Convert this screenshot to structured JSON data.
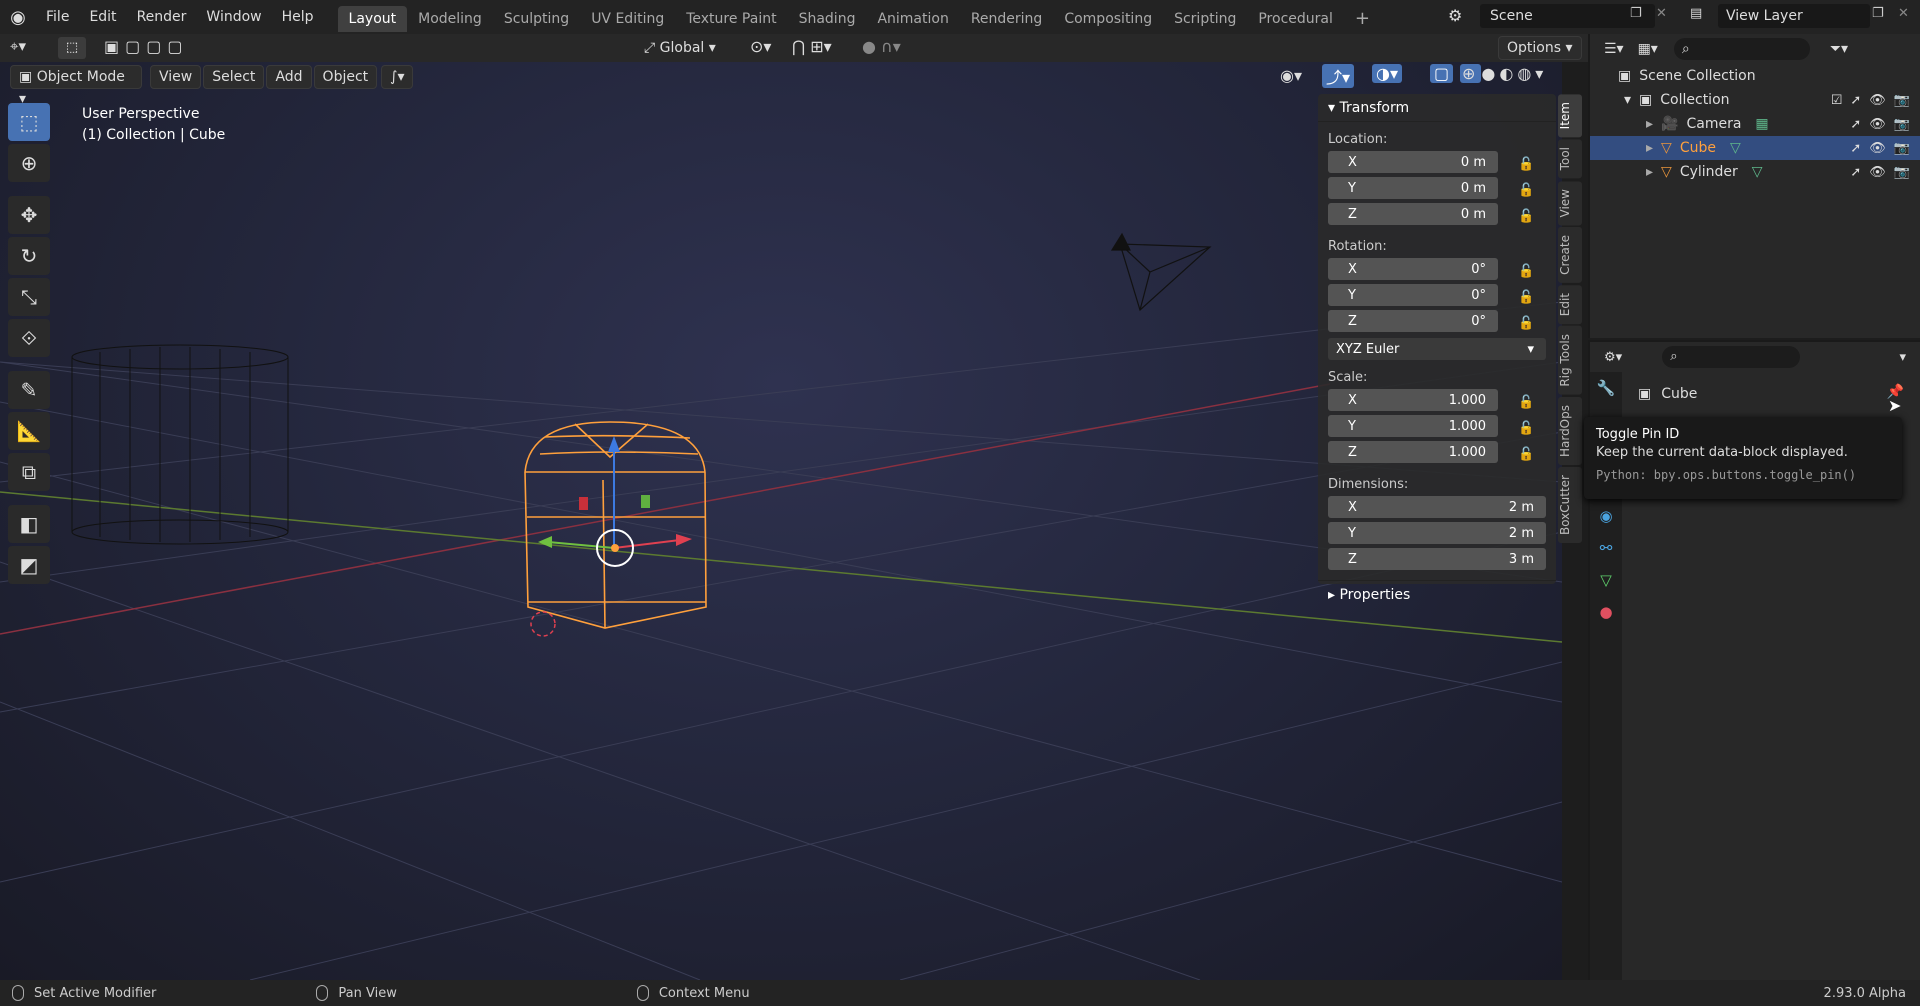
{
  "menu": [
    "File",
    "Edit",
    "Render",
    "Window",
    "Help"
  ],
  "workspaces": [
    "Layout",
    "Modeling",
    "Sculpting",
    "UV Editing",
    "Texture Paint",
    "Shading",
    "Animation",
    "Rendering",
    "Compositing",
    "Scripting",
    "Procedural"
  ],
  "active_workspace": "Layout",
  "scene_name": "Scene",
  "view_layer": "View Layer",
  "toolbar": {
    "orientation": "Global",
    "options": "Options"
  },
  "viewport_header": {
    "mode": "Object Mode",
    "view": "View",
    "select": "Select",
    "add": "Add",
    "object": "Object"
  },
  "viewport_info": {
    "perspective": "User Perspective",
    "context": "(1) Collection | Cube"
  },
  "npanel": {
    "section": "Transform",
    "location_label": "Location:",
    "location": [
      {
        "axis": "X",
        "value": "0 m"
      },
      {
        "axis": "Y",
        "value": "0 m"
      },
      {
        "axis": "Z",
        "value": "0 m"
      }
    ],
    "rotation_label": "Rotation:",
    "rotation": [
      {
        "axis": "X",
        "value": "0°"
      },
      {
        "axis": "Y",
        "value": "0°"
      },
      {
        "axis": "Z",
        "value": "0°"
      }
    ],
    "rotation_mode": "XYZ Euler",
    "scale_label": "Scale:",
    "scale": [
      {
        "axis": "X",
        "value": "1.000"
      },
      {
        "axis": "Y",
        "value": "1.000"
      },
      {
        "axis": "Z",
        "value": "1.000"
      }
    ],
    "dimensions_label": "Dimensions:",
    "dimensions": [
      {
        "axis": "X",
        "value": "2 m"
      },
      {
        "axis": "Y",
        "value": "2 m"
      },
      {
        "axis": "Z",
        "value": "3 m"
      }
    ],
    "properties": "Properties"
  },
  "vtabs": [
    "Item",
    "Tool",
    "View",
    "Create",
    "Edit",
    "Rig Tools",
    "HardOps",
    "BoxCutter"
  ],
  "outliner": {
    "root": "Scene Collection",
    "collection": "Collection",
    "items": [
      {
        "name": "Camera",
        "selected": false
      },
      {
        "name": "Cube",
        "selected": true
      },
      {
        "name": "Cylinder",
        "selected": false
      }
    ]
  },
  "properties": {
    "object_name": "Cube"
  },
  "tooltip": {
    "title": "Toggle Pin ID",
    "desc": "Keep the current data-block displayed.",
    "python": "Python: bpy.ops.buttons.toggle_pin()"
  },
  "status": {
    "left": "Set Active Modifier",
    "middle": "Pan View",
    "right": "Context Menu",
    "version": "2.93.0 Alpha"
  },
  "colors": {
    "accent": "#4772b3",
    "selected_object": "#ffa03c",
    "active_tab": "#404040"
  }
}
